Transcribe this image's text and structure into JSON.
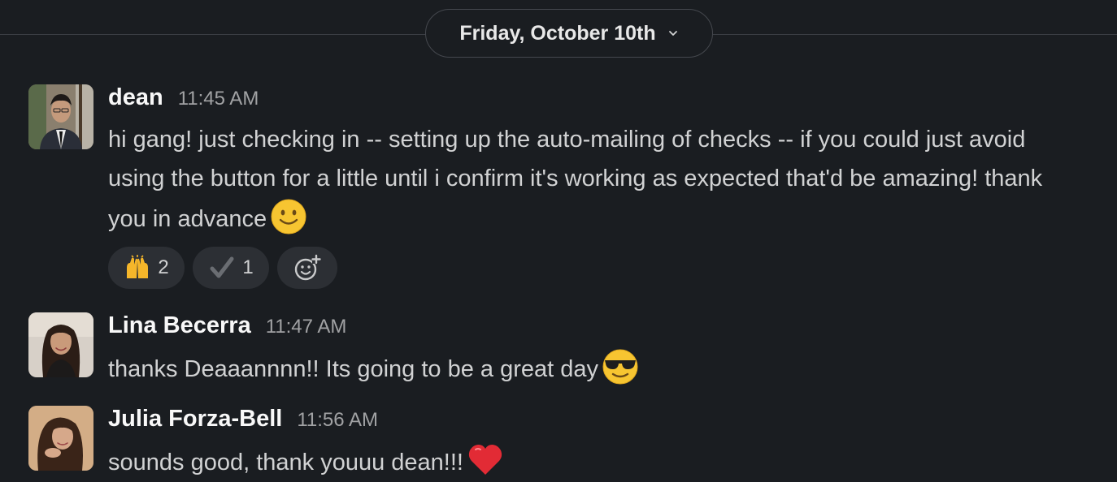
{
  "date_divider": {
    "label": "Friday, October 10th",
    "icon": "chevron-down-icon"
  },
  "messages": [
    {
      "user": "dean",
      "time": "11:45 AM",
      "text": "hi gang! just checking in -- setting up the auto-mailing of checks -- if you could just avoid using the button for a little until i confirm it's working as expected that'd be amazing! thank you in advance",
      "emoji": "slightly-smiling-face-icon",
      "reactions": [
        {
          "emoji": "raised-hands-icon",
          "count": "2"
        },
        {
          "emoji": "heavy-check-mark-icon",
          "count": "1"
        }
      ],
      "add_reaction_icon": "add-reaction-icon"
    },
    {
      "user": "Lina Becerra",
      "time": "11:47 AM",
      "text": "thanks Deaaannnn!! Its going to be a great day",
      "emoji": "sunglasses-face-icon"
    },
    {
      "user": "Julia Forza-Bell",
      "time": "11:56 AM",
      "text": "sounds good, thank youuu dean!!!",
      "emoji": "red-heart-icon"
    }
  ],
  "colors": {
    "background": "#1a1d21",
    "text": "#d1d2d3",
    "username": "#f8f8f8",
    "timestamp": "#a1a2a4",
    "reaction_bg": "#2c2f34"
  }
}
